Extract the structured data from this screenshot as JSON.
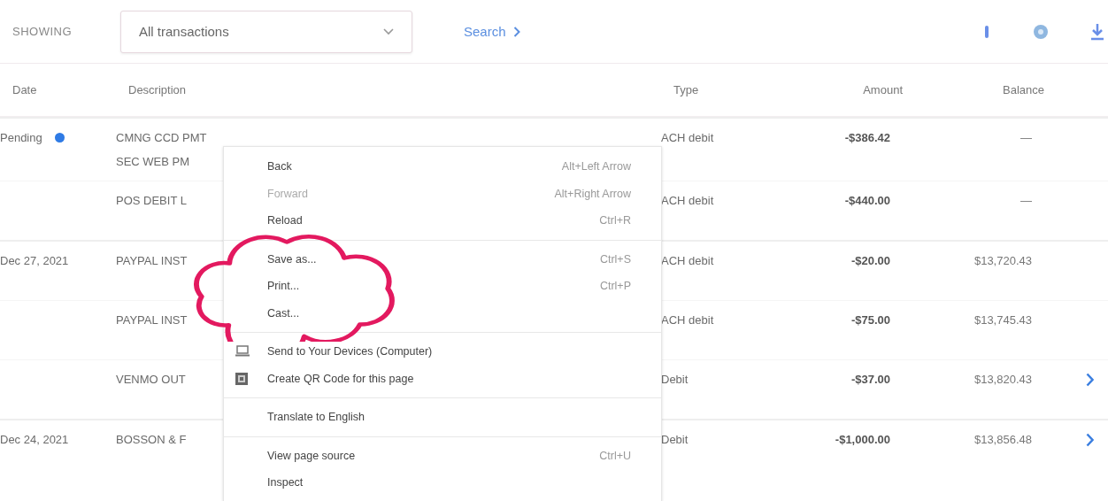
{
  "toolbar": {
    "showing_label": "SHOWING",
    "filter": {
      "value": "All transactions"
    },
    "search_link": "Search"
  },
  "table": {
    "columns": [
      "Date",
      "Description",
      "Type",
      "Amount",
      "Balance"
    ],
    "rows": [
      {
        "date": "Pending",
        "pending": true,
        "description": [
          "CMNG CCD PMT",
          "SEC WEB PM"
        ],
        "type": "ACH debit",
        "amount": "-$386.42",
        "balance": "—",
        "expandable": false,
        "group_start": true
      },
      {
        "date": "",
        "pending": false,
        "description": [
          "POS DEBIT L"
        ],
        "type": "ACH debit",
        "amount": "-$440.00",
        "balance": "—",
        "expandable": false,
        "group_start": false
      },
      {
        "date": "Dec 27, 2021",
        "pending": false,
        "description": [
          "PAYPAL INST"
        ],
        "type": "ACH debit",
        "amount": "-$20.00",
        "balance": "$13,720.43",
        "expandable": false,
        "group_start": true
      },
      {
        "date": "",
        "pending": false,
        "description": [
          "PAYPAL INST"
        ],
        "type": "ACH debit",
        "amount": "-$75.00",
        "balance": "$13,745.43",
        "expandable": false,
        "group_start": false
      },
      {
        "date": "",
        "pending": false,
        "description": [
          "VENMO OUT"
        ],
        "type": "Debit",
        "amount": "-$37.00",
        "balance": "$13,820.43",
        "expandable": true,
        "group_start": false
      },
      {
        "date": "Dec 24, 2021",
        "pending": false,
        "description": [
          "BOSSON & F"
        ],
        "type": "Debit",
        "amount": "-$1,000.00",
        "balance": "$13,856.48",
        "expandable": true,
        "group_start": true
      }
    ]
  },
  "context_menu": {
    "items": [
      {
        "kind": "item",
        "label": "Back",
        "shortcut": "Alt+Left Arrow",
        "disabled": false
      },
      {
        "kind": "item",
        "label": "Forward",
        "shortcut": "Alt+Right Arrow",
        "disabled": true
      },
      {
        "kind": "item",
        "label": "Reload",
        "shortcut": "Ctrl+R",
        "disabled": false
      },
      {
        "kind": "separator"
      },
      {
        "kind": "item",
        "label": "Save as...",
        "shortcut": "Ctrl+S",
        "disabled": false
      },
      {
        "kind": "item",
        "label": "Print...",
        "shortcut": "Ctrl+P",
        "disabled": false
      },
      {
        "kind": "item",
        "label": "Cast...",
        "disabled": false
      },
      {
        "kind": "separator"
      },
      {
        "kind": "send",
        "label": "Send to Your Devices (Computer)",
        "disabled": false
      },
      {
        "kind": "qr",
        "label": "Create QR Code for this page",
        "disabled": false
      },
      {
        "kind": "separator"
      },
      {
        "kind": "item",
        "label": "Translate to English",
        "disabled": false
      },
      {
        "kind": "separator"
      },
      {
        "kind": "item",
        "label": "View page source",
        "shortcut": "Ctrl+U",
        "disabled": false
      },
      {
        "kind": "item",
        "label": "Inspect",
        "disabled": false
      }
    ]
  },
  "annotation": {
    "kind": "cloud"
  }
}
